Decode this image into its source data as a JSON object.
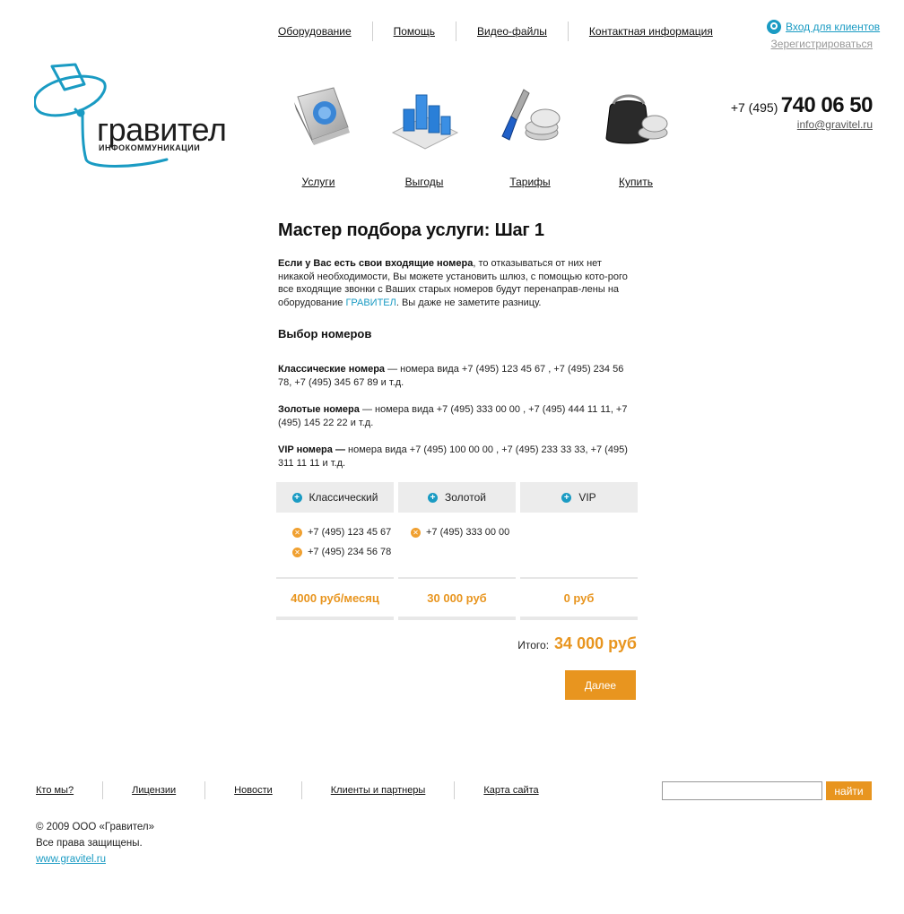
{
  "topnav": {
    "items": [
      "Оборудование",
      "Помощь",
      "Видео-файлы",
      "Контактная информация"
    ]
  },
  "account": {
    "login": "Вход для клиентов",
    "register": "Зерегистрироваться"
  },
  "logo": {
    "word": "гравител",
    "sub": "ИНФОКОММУНИКАЦИИ"
  },
  "contact": {
    "phone_prefix": "+7 (495)",
    "phone_number": "740 06 50",
    "email": "info@gravitel.ru"
  },
  "iconnav": {
    "items": [
      {
        "label": "Услуги",
        "icon": "book-icon"
      },
      {
        "label": "Выгоды",
        "icon": "bar-chart-icon"
      },
      {
        "label": "Тарифы",
        "icon": "screwdriver-coins-icon"
      },
      {
        "label": "Купить",
        "icon": "wallet-coins-icon"
      }
    ]
  },
  "main": {
    "title": "Мастер подбора услуги: Шаг 1",
    "intro_bold": "Если у Вас есть свои входящие номера",
    "intro_text1": ", то отказываться от них нет никакой необходимости, Вы можете установить шлюз, с помощью кото-рого все входящие звонки с Ваших старых номеров будут перенаправ-лены на оборудование ",
    "intro_brand": "ГРАВИТЕЛ",
    "intro_text2": ". Вы даже не заметите разницу.",
    "subtitle": "Выбор номеров",
    "classic_bold": "Классические номера",
    "classic_text": " — номера вида  +7 (495) 123 45 67 ,  +7 (495) 234 56 78, +7 (495) 345 67 89 и т.д.",
    "gold_bold": "Золотые номера",
    "gold_text": " — номера вида  +7 (495) 333 00 00 ,  +7 (495) 444 11 11, +7 (495) 145 22 22 и т.д.",
    "vip_bold": "VIP номера —",
    "vip_text": " номера вида  +7 (495) 100 00 00 ,  +7 (495) 233 33 33, +7 (495) 311 11 11 и т.д."
  },
  "columns": [
    {
      "label": "Классический",
      "numbers": [
        "+7 (495) 123 45 67",
        "+7 (495) 234 56 78"
      ],
      "price": "4000 руб/месяц"
    },
    {
      "label": "Золотой",
      "numbers": [
        "+7 (495) 333 00 00"
      ],
      "price": "30 000 руб"
    },
    {
      "label": "VIP",
      "numbers": [],
      "price": "0 руб"
    }
  ],
  "total": {
    "label": "Итого:",
    "value": "34 000 руб"
  },
  "next_button": "Далее",
  "footer": {
    "nav": [
      "Кто мы?",
      "Лицензии",
      "Новости",
      "Клиенты и партнеры",
      "Карта сайта"
    ],
    "search_button": "найти",
    "copyright": "© 2009 ООО «Гравител»",
    "rights": "Все права защищены.",
    "site": "www.gravitel.ru"
  },
  "colors": {
    "accent_orange": "#e8951f",
    "accent_blue": "#1a9bc3"
  }
}
